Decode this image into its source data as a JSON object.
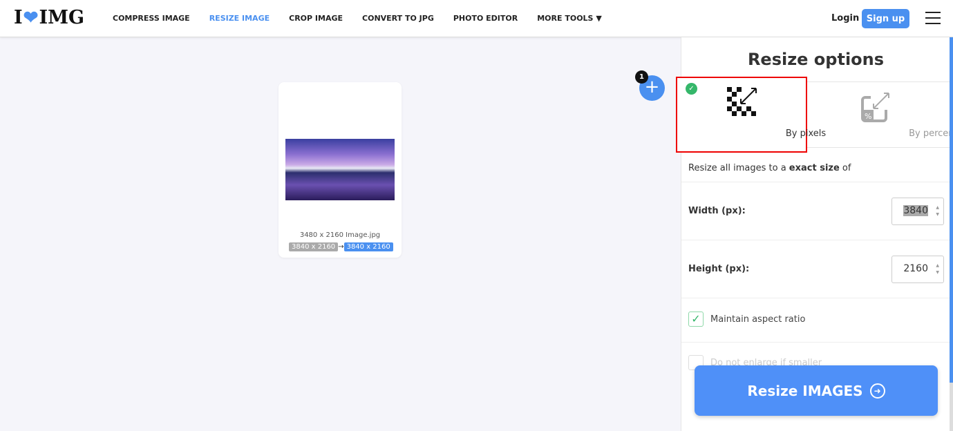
{
  "header": {
    "logo": "I ❤ IMG",
    "nav": [
      "COMPRESS IMAGE",
      "RESIZE IMAGE",
      "CROP IMAGE",
      "CONVERT TO JPG",
      "PHOTO EDITOR",
      "MORE TOOLS"
    ],
    "active_nav": "RESIZE IMAGE",
    "login": "Login",
    "signup": "Sign up"
  },
  "file": {
    "name": "3480 x 2160 Image.jpg",
    "original": "3840 x 2160",
    "new": "3840 x 2160",
    "count": "1"
  },
  "panel": {
    "title": "Resize options",
    "tabs": [
      {
        "label": "By pixels",
        "selected": true
      },
      {
        "label": "By percentage",
        "selected": false
      }
    ],
    "desc_pre": "Resize all images to a ",
    "desc_bold": "exact size",
    "desc_post": " of",
    "width_label": "Width (px):",
    "width": "3840",
    "height_label": "Height (px):",
    "height": "2160",
    "aspect_label": "Maintain aspect ratio",
    "aspect_checked": true,
    "enlarge_label": "Do not enlarge if smaller",
    "enlarge_checked": false
  },
  "action": {
    "label": "Resize IMAGES"
  },
  "colors": {
    "accent": "#4a90f0",
    "success": "#35b76a",
    "highlight": "#e00000"
  }
}
